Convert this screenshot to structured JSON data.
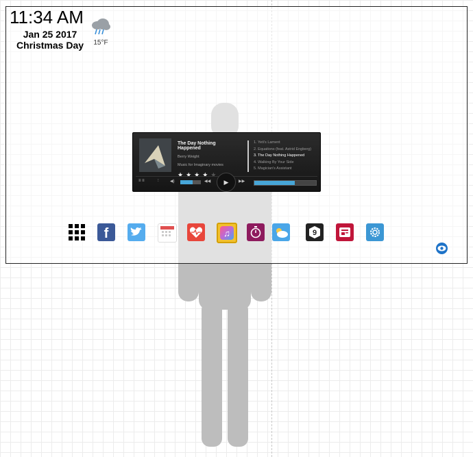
{
  "clock": {
    "time": "11:34 AM",
    "date": "Jan 25 2017",
    "holiday": "Christmas Day"
  },
  "weather": {
    "icon": "rain-cloud-icon",
    "temperature": "15°F"
  },
  "player": {
    "track_title": "The Day Nothing Happened",
    "artist": "Berry Weight",
    "album": "Music for Imaginary movies",
    "rating": 4,
    "rating_max": 5,
    "playlist": [
      "1. Yeti's Lament",
      "2. Equations (feat. Astrid Engberg)",
      "3. The Day Nothing Happened",
      "4. Walking By Your Side",
      "5. Magician's Assistant"
    ],
    "active_index": 2,
    "volume_fraction": 0.6,
    "progress_fraction": 0.65,
    "accent": "#47a6d8"
  },
  "apps": [
    {
      "name": "apps-grid",
      "color": "#000000"
    },
    {
      "name": "facebook",
      "color": "#3b5998"
    },
    {
      "name": "twitter",
      "color": "#55acee"
    },
    {
      "name": "calendar",
      "color": "#e05050"
    },
    {
      "name": "health",
      "color": "#e8463b"
    },
    {
      "name": "music",
      "color": "#b96bd8"
    },
    {
      "name": "timer",
      "color": "#8e1b5e"
    },
    {
      "name": "weather",
      "color": "#4aa6e8"
    },
    {
      "name": "9gag",
      "color": "#222222"
    },
    {
      "name": "news",
      "color": "#c0163a"
    },
    {
      "name": "settings",
      "color": "#3c97d4"
    }
  ],
  "eye_icon": "eye-icon"
}
